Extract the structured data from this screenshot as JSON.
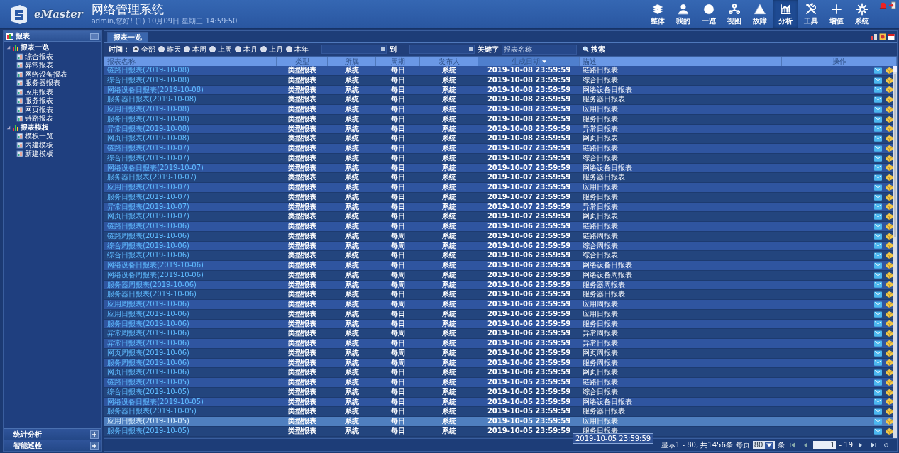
{
  "header": {
    "title": "网络管理系统",
    "subtitle": "admin,您好! (1) 10月09日 星期三 14:59:50",
    "logo_text": "eMaster",
    "nav": [
      {
        "label": "整体",
        "selected": false
      },
      {
        "label": "我的",
        "selected": false
      },
      {
        "label": "一览",
        "selected": false
      },
      {
        "label": "视图",
        "selected": false
      },
      {
        "label": "故障",
        "selected": false
      },
      {
        "label": "分析",
        "selected": true
      },
      {
        "label": "工具",
        "selected": false
      },
      {
        "label": "增值",
        "selected": false
      },
      {
        "label": "系统",
        "selected": false
      }
    ]
  },
  "sidebar": {
    "title": "报表",
    "tree": [
      {
        "label": "报表一览",
        "expanded": true,
        "children": [
          {
            "label": "综合报表"
          },
          {
            "label": "异常报表"
          },
          {
            "label": "网络设备报表"
          },
          {
            "label": "服务器报表"
          },
          {
            "label": "应用报表"
          },
          {
            "label": "服务报表"
          },
          {
            "label": "网页报表"
          },
          {
            "label": "链路报表"
          }
        ]
      },
      {
        "label": "报表模板",
        "expanded": true,
        "children": [
          {
            "label": "模板一览"
          },
          {
            "label": "内建模板"
          },
          {
            "label": "新建模板"
          }
        ]
      }
    ],
    "bottom_panels": [
      "统计分析",
      "智能巡检"
    ]
  },
  "tab": {
    "label": "报表一览",
    "selected": true
  },
  "filter": {
    "label": "时间：",
    "options": [
      {
        "label": "全部",
        "selected": true
      },
      {
        "label": "昨天",
        "selected": false
      },
      {
        "label": "本周",
        "selected": false
      },
      {
        "label": "上周",
        "selected": false
      },
      {
        "label": "本月",
        "selected": false
      },
      {
        "label": "上月",
        "selected": false
      },
      {
        "label": "本年",
        "selected": false
      }
    ],
    "to_label": "到",
    "keyword_label": "关键字",
    "keyword_placeholder": "报表名称",
    "search_button": "搜索"
  },
  "table": {
    "columns": [
      {
        "label": "报表名称",
        "sorted": false
      },
      {
        "label": "类型",
        "sorted": false
      },
      {
        "label": "所属",
        "sorted": false
      },
      {
        "label": "周期",
        "sorted": false
      },
      {
        "label": "发布人",
        "sorted": false
      },
      {
        "label": "生成日期",
        "sorted": true
      },
      {
        "label": "描述",
        "sorted": false
      },
      {
        "label": "操作",
        "sorted": false
      }
    ],
    "rows": [
      {
        "name": "链路日报表(2019-10-08)",
        "type": "类型报表",
        "owner": "系统",
        "period": "每日",
        "publisher": "系统",
        "date": "2019-10-08 23:59:59",
        "desc": "链路日报表",
        "selected": false
      },
      {
        "name": "综合日报表(2019-10-08)",
        "type": "类型报表",
        "owner": "系统",
        "period": "每日",
        "publisher": "系统",
        "date": "2019-10-08 23:59:59",
        "desc": "综合日报表",
        "selected": false
      },
      {
        "name": "网络设备日报表(2019-10-08)",
        "type": "类型报表",
        "owner": "系统",
        "period": "每日",
        "publisher": "系统",
        "date": "2019-10-08 23:59:59",
        "desc": "网络设备日报表",
        "selected": false
      },
      {
        "name": "服务器日报表(2019-10-08)",
        "type": "类型报表",
        "owner": "系统",
        "period": "每日",
        "publisher": "系统",
        "date": "2019-10-08 23:59:59",
        "desc": "服务器日报表",
        "selected": false
      },
      {
        "name": "应用日报表(2019-10-08)",
        "type": "类型报表",
        "owner": "系统",
        "period": "每日",
        "publisher": "系统",
        "date": "2019-10-08 23:59:59",
        "desc": "应用日报表",
        "selected": false
      },
      {
        "name": "服务日报表(2019-10-08)",
        "type": "类型报表",
        "owner": "系统",
        "period": "每日",
        "publisher": "系统",
        "date": "2019-10-08 23:59:59",
        "desc": "服务日报表",
        "selected": false
      },
      {
        "name": "异常日报表(2019-10-08)",
        "type": "类型报表",
        "owner": "系统",
        "period": "每日",
        "publisher": "系统",
        "date": "2019-10-08 23:59:59",
        "desc": "异常日报表",
        "selected": false
      },
      {
        "name": "网页日报表(2019-10-08)",
        "type": "类型报表",
        "owner": "系统",
        "period": "每日",
        "publisher": "系统",
        "date": "2019-10-08 23:59:59",
        "desc": "网页日报表",
        "selected": false
      },
      {
        "name": "链路日报表(2019-10-07)",
        "type": "类型报表",
        "owner": "系统",
        "period": "每日",
        "publisher": "系统",
        "date": "2019-10-07 23:59:59",
        "desc": "链路日报表",
        "selected": false
      },
      {
        "name": "综合日报表(2019-10-07)",
        "type": "类型报表",
        "owner": "系统",
        "period": "每日",
        "publisher": "系统",
        "date": "2019-10-07 23:59:59",
        "desc": "综合日报表",
        "selected": false
      },
      {
        "name": "网络设备日报表(2019-10-07)",
        "type": "类型报表",
        "owner": "系统",
        "period": "每日",
        "publisher": "系统",
        "date": "2019-10-07 23:59:59",
        "desc": "网络设备日报表",
        "selected": false
      },
      {
        "name": "服务器日报表(2019-10-07)",
        "type": "类型报表",
        "owner": "系统",
        "period": "每日",
        "publisher": "系统",
        "date": "2019-10-07 23:59:59",
        "desc": "服务器日报表",
        "selected": false
      },
      {
        "name": "应用日报表(2019-10-07)",
        "type": "类型报表",
        "owner": "系统",
        "period": "每日",
        "publisher": "系统",
        "date": "2019-10-07 23:59:59",
        "desc": "应用日报表",
        "selected": false
      },
      {
        "name": "服务日报表(2019-10-07)",
        "type": "类型报表",
        "owner": "系统",
        "period": "每日",
        "publisher": "系统",
        "date": "2019-10-07 23:59:59",
        "desc": "服务日报表",
        "selected": false
      },
      {
        "name": "异常日报表(2019-10-07)",
        "type": "类型报表",
        "owner": "系统",
        "period": "每日",
        "publisher": "系统",
        "date": "2019-10-07 23:59:59",
        "desc": "异常日报表",
        "selected": false
      },
      {
        "name": "网页日报表(2019-10-07)",
        "type": "类型报表",
        "owner": "系统",
        "period": "每日",
        "publisher": "系统",
        "date": "2019-10-07 23:59:59",
        "desc": "网页日报表",
        "selected": false
      },
      {
        "name": "链路日报表(2019-10-06)",
        "type": "类型报表",
        "owner": "系统",
        "period": "每日",
        "publisher": "系统",
        "date": "2019-10-06 23:59:59",
        "desc": "链路日报表",
        "selected": false
      },
      {
        "name": "链路周报表(2019-10-06)",
        "type": "类型报表",
        "owner": "系统",
        "period": "每周",
        "publisher": "系统",
        "date": "2019-10-06 23:59:59",
        "desc": "链路周报表",
        "selected": false
      },
      {
        "name": "综合周报表(2019-10-06)",
        "type": "类型报表",
        "owner": "系统",
        "period": "每周",
        "publisher": "系统",
        "date": "2019-10-06 23:59:59",
        "desc": "综合周报表",
        "selected": false
      },
      {
        "name": "综合日报表(2019-10-06)",
        "type": "类型报表",
        "owner": "系统",
        "period": "每日",
        "publisher": "系统",
        "date": "2019-10-06 23:59:59",
        "desc": "综合日报表",
        "selected": false
      },
      {
        "name": "网络设备日报表(2019-10-06)",
        "type": "类型报表",
        "owner": "系统",
        "period": "每日",
        "publisher": "系统",
        "date": "2019-10-06 23:59:59",
        "desc": "网络设备日报表",
        "selected": false
      },
      {
        "name": "网络设备周报表(2019-10-06)",
        "type": "类型报表",
        "owner": "系统",
        "period": "每周",
        "publisher": "系统",
        "date": "2019-10-06 23:59:59",
        "desc": "网络设备周报表",
        "selected": false
      },
      {
        "name": "服务器周报表(2019-10-06)",
        "type": "类型报表",
        "owner": "系统",
        "period": "每周",
        "publisher": "系统",
        "date": "2019-10-06 23:59:59",
        "desc": "服务器周报表",
        "selected": false
      },
      {
        "name": "服务器日报表(2019-10-06)",
        "type": "类型报表",
        "owner": "系统",
        "period": "每日",
        "publisher": "系统",
        "date": "2019-10-06 23:59:59",
        "desc": "服务器日报表",
        "selected": false
      },
      {
        "name": "应用周报表(2019-10-06)",
        "type": "类型报表",
        "owner": "系统",
        "period": "每周",
        "publisher": "系统",
        "date": "2019-10-06 23:59:59",
        "desc": "应用周报表",
        "selected": false
      },
      {
        "name": "应用日报表(2019-10-06)",
        "type": "类型报表",
        "owner": "系统",
        "period": "每日",
        "publisher": "系统",
        "date": "2019-10-06 23:59:59",
        "desc": "应用日报表",
        "selected": false
      },
      {
        "name": "服务日报表(2019-10-06)",
        "type": "类型报表",
        "owner": "系统",
        "period": "每日",
        "publisher": "系统",
        "date": "2019-10-06 23:59:59",
        "desc": "服务日报表",
        "selected": false
      },
      {
        "name": "异常周报表(2019-10-06)",
        "type": "类型报表",
        "owner": "系统",
        "period": "每周",
        "publisher": "系统",
        "date": "2019-10-06 23:59:59",
        "desc": "异常周报表",
        "selected": false
      },
      {
        "name": "异常日报表(2019-10-06)",
        "type": "类型报表",
        "owner": "系统",
        "period": "每日",
        "publisher": "系统",
        "date": "2019-10-06 23:59:59",
        "desc": "异常日报表",
        "selected": false
      },
      {
        "name": "网页周报表(2019-10-06)",
        "type": "类型报表",
        "owner": "系统",
        "period": "每周",
        "publisher": "系统",
        "date": "2019-10-06 23:59:59",
        "desc": "网页周报表",
        "selected": false
      },
      {
        "name": "服务周报表(2019-10-06)",
        "type": "类型报表",
        "owner": "系统",
        "period": "每周",
        "publisher": "系统",
        "date": "2019-10-06 23:59:59",
        "desc": "服务周报表",
        "selected": false
      },
      {
        "name": "网页日报表(2019-10-06)",
        "type": "类型报表",
        "owner": "系统",
        "period": "每日",
        "publisher": "系统",
        "date": "2019-10-06 23:59:59",
        "desc": "网页日报表",
        "selected": false
      },
      {
        "name": "链路日报表(2019-10-05)",
        "type": "类型报表",
        "owner": "系统",
        "period": "每日",
        "publisher": "系统",
        "date": "2019-10-05 23:59:59",
        "desc": "链路日报表",
        "selected": false
      },
      {
        "name": "综合日报表(2019-10-05)",
        "type": "类型报表",
        "owner": "系统",
        "period": "每日",
        "publisher": "系统",
        "date": "2019-10-05 23:59:59",
        "desc": "综合日报表",
        "selected": false
      },
      {
        "name": "网络设备日报表(2019-10-05)",
        "type": "类型报表",
        "owner": "系统",
        "period": "每日",
        "publisher": "系统",
        "date": "2019-10-05 23:59:59",
        "desc": "网络设备日报表",
        "selected": false
      },
      {
        "name": "服务器日报表(2019-10-05)",
        "type": "类型报表",
        "owner": "系统",
        "period": "每日",
        "publisher": "系统",
        "date": "2019-10-05 23:59:59",
        "desc": "服务器日报表",
        "selected": false
      },
      {
        "name": "应用日报表(2019-10-05)",
        "type": "类型报表",
        "owner": "系统",
        "period": "每日",
        "publisher": "系统",
        "date": "2019-10-05 23:59:59",
        "desc": "应用日报表",
        "selected": true
      },
      {
        "name": "服务日报表(2019-10-05)",
        "type": "类型报表",
        "owner": "系统",
        "period": "每日",
        "publisher": "系统",
        "date": "2019-10-05 23:59:59",
        "desc": "服务日报表",
        "selected": false
      }
    ],
    "tooltip": "2019-10-05 23:59:59"
  },
  "pager": {
    "summary": "显示1 - 80, 共1456条",
    "per_page_label": "每页",
    "per_page": "80",
    "unit": "条",
    "page": "1",
    "total": "- 19"
  }
}
